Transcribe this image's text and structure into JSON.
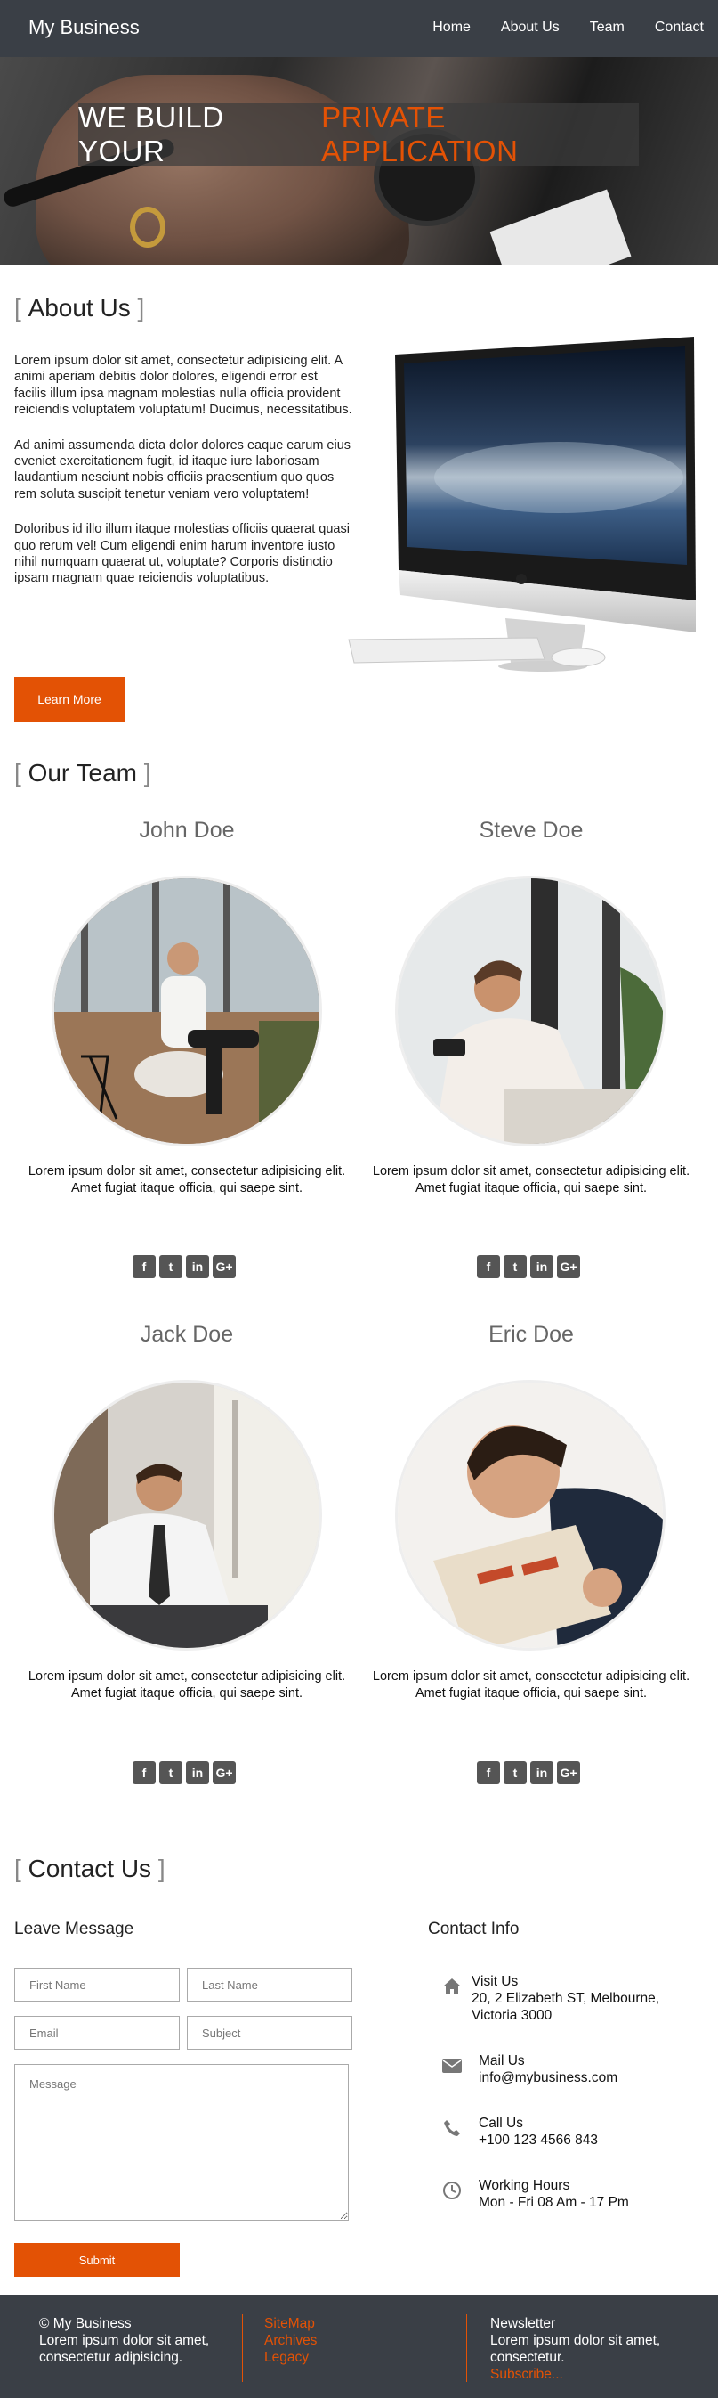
{
  "nav": {
    "brand": "My Business",
    "links": [
      "Home",
      "About Us",
      "Team",
      "Contact"
    ]
  },
  "hero": {
    "title_white": "WE BUILD YOUR",
    "title_orange": "PRIVATE APPLICATION"
  },
  "about": {
    "title": "About Us",
    "paragraphs": [
      "Lorem ipsum dolor sit amet, consectetur adipisicing elit. A animi aperiam debitis dolor dolores, eligendi error est facilis illum ipsa magnam molestias nulla officia provident reiciendis voluptatem voluptatum! Ducimus, necessitatibus.",
      "Ad animi assumenda dicta dolor dolores eaque earum eius eveniet exercitationem fugit, id itaque iure laboriosam laudantium nesciunt nobis officiis praesentium quo quos rem soluta suscipit tenetur veniam vero voluptatem!",
      "Doloribus id illo illum itaque molestias officiis quaerat quasi quo rerum vel! Cum eligendi enim harum inventore iusto nihil numquam quaerat ut, voluptate? Corporis distinctio ipsam magnam quae reiciendis voluptatibus."
    ],
    "button": "Learn More"
  },
  "team": {
    "title": "Our Team",
    "members": [
      {
        "name": "John Doe",
        "desc": "Lorem ipsum dolor sit amet, consectetur adipisicing elit. Amet fugiat itaque officia, qui saepe sint."
      },
      {
        "name": "Steve Doe",
        "desc": "Lorem ipsum dolor sit amet, consectetur adipisicing elit. Amet fugiat itaque officia, qui saepe sint."
      },
      {
        "name": "Jack Doe",
        "desc": "Lorem ipsum dolor sit amet, consectetur adipisicing elit. Amet fugiat itaque officia, qui saepe sint."
      },
      {
        "name": "Eric Doe",
        "desc": "Lorem ipsum dolor sit amet, consectetur adipisicing elit. Amet fugiat itaque officia, qui saepe sint."
      }
    ],
    "social_icons": [
      "facebook-icon",
      "twitter-icon",
      "linkedin-icon",
      "google-plus-icon"
    ]
  },
  "contact": {
    "title": "Contact Us",
    "form_title": "Leave Message",
    "placeholders": {
      "first_name": "First Name",
      "last_name": "Last Name",
      "email": "Email",
      "subject": "Subject",
      "message": "Message"
    },
    "submit": "Submit",
    "info_title": "Contact Info",
    "info": {
      "visit_label": "Visit Us",
      "visit_line1": "20, 2 Elizabeth ST, Melbourne,",
      "visit_line2": "Victoria 3000",
      "mail_label": "Mail Us",
      "mail_value": "info@mybusiness.com",
      "call_label": "Call Us",
      "call_value": "+100 123 4566 843",
      "hours_label": "Working Hours",
      "hours_value": "Mon - Fri 08 Am - 17 Pm"
    }
  },
  "footer": {
    "copyright": "© My Business",
    "desc_line1": "Lorem ipsum dolor sit amet,",
    "desc_line2": "consectetur adipisicing.",
    "links": [
      "SiteMap",
      "Archives",
      "Legacy"
    ],
    "newsletter_title": "Newsletter",
    "newsletter_line1": "Lorem ipsum dolor sit amet,",
    "newsletter_line2": "consectetur.",
    "subscribe": "Subscribe..."
  },
  "colors": {
    "accent": "#e35205",
    "nav_bg": "#3a3f46",
    "footer_bg": "#3a3f46"
  }
}
